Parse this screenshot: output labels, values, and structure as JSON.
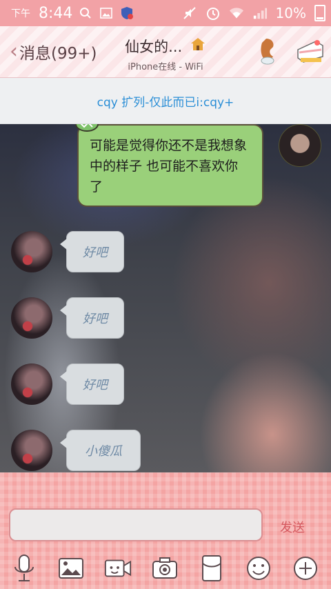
{
  "status_bar": {
    "ampm": "下午",
    "time": "8:44",
    "battery": "10%"
  },
  "header": {
    "back_label": "消息(99+)",
    "title": "仙女的...",
    "subtitle": "iPhone在线 - WiFi"
  },
  "banner": {
    "text": "cqy 扩列-仅此而已i:cqy+"
  },
  "messages": [
    {
      "from": "self",
      "text": "可能是觉得你还不是我想象中的样子 也可能不喜欢你了"
    },
    {
      "from": "other",
      "text": "好吧"
    },
    {
      "from": "other",
      "text": "好吧"
    },
    {
      "from": "other",
      "text": "好吧"
    },
    {
      "from": "other",
      "text": "小傻瓜"
    }
  ],
  "input": {
    "placeholder": "",
    "send_label": "发送"
  },
  "toolbar": {
    "icons": [
      "microphone-icon",
      "picture-icon",
      "video-call-icon",
      "camera-icon",
      "red-packet-icon",
      "emoji-icon",
      "plus-icon"
    ]
  },
  "colors": {
    "accent": "#f2a2a6",
    "send": "#d5595f",
    "link": "#2a8ed6",
    "self_bubble": "#9ad07a"
  }
}
